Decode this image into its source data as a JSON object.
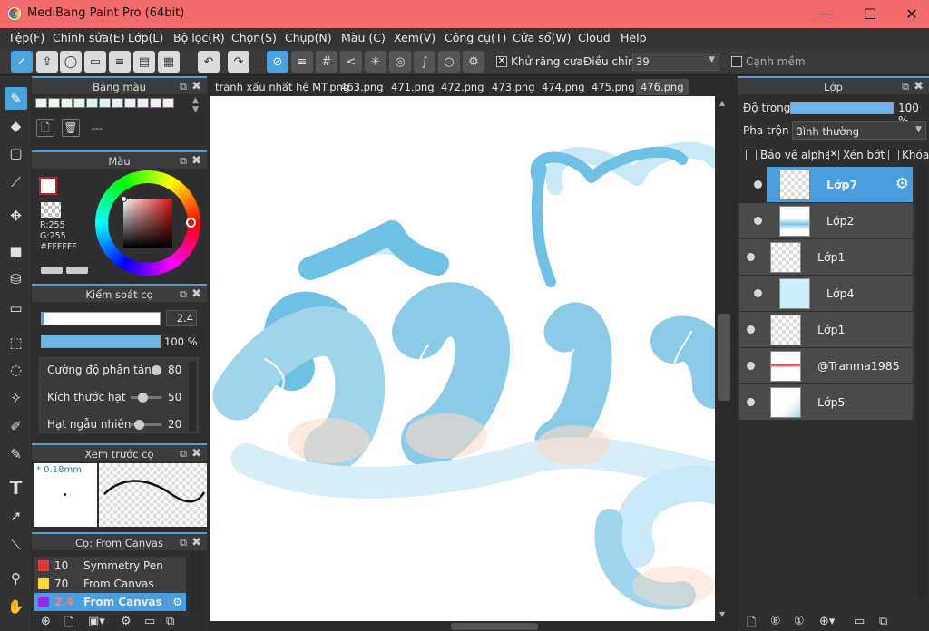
{
  "window": {
    "title": "MediBang Paint Pro (64bit)",
    "controls": {
      "minimize": "—",
      "maximize": "☐",
      "close": "✕"
    }
  },
  "menu": [
    "Tệp(F)",
    "Chỉnh sửa(E)",
    "Lớp(L)",
    "Bộ lọc(R)",
    "Chọn(S)",
    "Chụp(N)",
    "Màu (C)",
    "Xem(V)",
    "Công cụ(T)",
    "Cửa sổ(W)",
    "Cloud",
    "Help"
  ],
  "toolbar": {
    "antialias_label": "Khử răng cưa",
    "adjust_label": "Điều chỉnh",
    "adjust_value": "39",
    "soft_edge_label": "Cạnh mềm",
    "antialias_checked": true,
    "soft_edge_checked": false
  },
  "left_tools": [
    "brush-icon",
    "eraser-icon",
    "rectangle-icon",
    "pen-line-icon",
    "move-icon",
    "fill-rect-icon",
    "bucket-icon",
    "gradient-icon",
    "select-rect-icon",
    "lasso-icon",
    "magic-wand-icon",
    "select-pen-icon",
    "select-eraser-icon",
    "text-icon",
    "operation-icon",
    "eyedropper-icon",
    "hand-icon"
  ],
  "palette_panel": {
    "title": "Bảng màu",
    "none_label": "---"
  },
  "color_panel": {
    "title": "Màu",
    "r_label": "R:255",
    "g_label": "G:255",
    "hex_label": "#FFFFFF",
    "primary_color": "#ffffff",
    "accent_color": "#cc1f1f"
  },
  "brush_control": {
    "title": "Kiểm soát cọ",
    "size_value": "2.4",
    "opacity_value": "100 %",
    "params": [
      {
        "label": "Cường độ phân tán",
        "value": "80"
      },
      {
        "label": "Kích thước hạt",
        "value": "50"
      },
      {
        "label": "Hạt ngẫu nhiên",
        "value": "20"
      }
    ]
  },
  "brush_preview": {
    "title": "Xem trước cọ",
    "size_label": "* 0.18mm"
  },
  "brush_list": {
    "title": "Cọ: From Canvas",
    "items": [
      {
        "size": "10",
        "name": "Symmetry Pen",
        "color": "#e53935"
      },
      {
        "size": "70",
        "name": "From Canvas",
        "color": "#fdd835"
      },
      {
        "size": "2.4",
        "name": "From Canvas",
        "color": "#9c27f0",
        "selected": true
      }
    ]
  },
  "tabs": [
    "tranh xấu nhất hệ MT.png",
    "463.png",
    "471.png",
    "472.png",
    "473.png",
    "474.png",
    "475.png",
    "476.png"
  ],
  "active_tab": "476.png",
  "layer_panel": {
    "title": "Lớp",
    "opacity_label": "Độ trong",
    "opacity_value": "100 %",
    "blend_label": "Pha trộn",
    "blend_value": "Bình thường",
    "protect_alpha_label": "Bảo vệ alpha",
    "clipping_label": "Xén bớt",
    "lock_label": "Khóa",
    "layers": [
      {
        "name": "Lớp7",
        "selected": true
      },
      {
        "name": "Lớp2"
      },
      {
        "name": "Lớp1"
      },
      {
        "name": "Lớp4"
      },
      {
        "name": "Lớp1"
      },
      {
        "name": "@Tranma1985"
      },
      {
        "name": "Lớp5"
      }
    ]
  }
}
